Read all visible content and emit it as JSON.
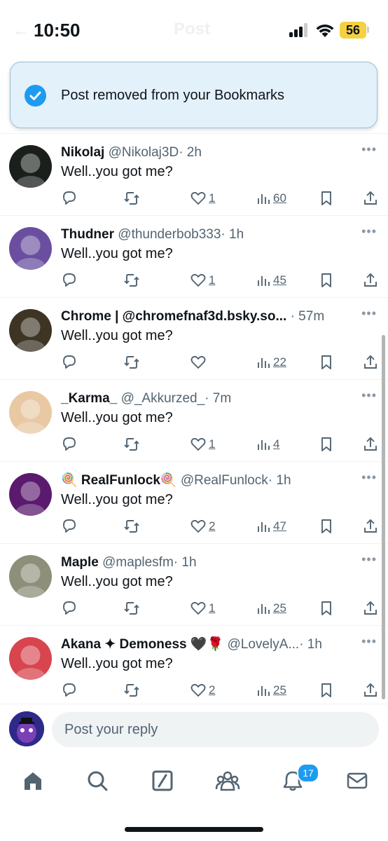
{
  "status_bar": {
    "time": "10:50",
    "battery": "56",
    "faded_title": "Post"
  },
  "toast": {
    "message": "Post removed from your Bookmarks"
  },
  "posts": [
    {
      "name": "Nikolaj",
      "handle": "@Nikolaj3D",
      "time": "· 2h",
      "text": "Well..you got me?",
      "likes": "1",
      "views": "60",
      "avatar_color": "#1a1f1c"
    },
    {
      "name": "Thudner",
      "handle": "@thunderbob333",
      "time": "· 1h",
      "text": "Well..you got me?",
      "likes": "1",
      "views": "45",
      "avatar_color": "#6a4fa0"
    },
    {
      "name": "Chrome | @chromefnaf3d.bsky.so...",
      "handle": "",
      "time": "· 57m",
      "text": "Well..you got me?",
      "likes": "",
      "views": "22",
      "avatar_color": "#3d3424"
    },
    {
      "name": "_Karma_",
      "handle": "@_Akkurzed_",
      "time": "· 7m",
      "text": "Well..you got me?",
      "likes": "1",
      "views": "4",
      "avatar_color": "#e9c8a4"
    },
    {
      "name": "🍭 RealFunlock🍭",
      "handle": "@RealFunlock",
      "time": "· 1h",
      "text": "Well..you got me?",
      "likes": "2",
      "views": "47",
      "avatar_color": "#5a1a6e"
    },
    {
      "name": "Maple",
      "handle": "@maplesfm",
      "time": "· 1h",
      "text": "Well..you got me?",
      "likes": "1",
      "views": "25",
      "avatar_color": "#8d8f7a"
    },
    {
      "name": "Akana ✦ Demoness 🖤🌹",
      "handle": "@LovelyA...",
      "time": "· 1h",
      "text": "Well..you got me?",
      "likes": "2",
      "views": "25",
      "avatar_color": "#d8454f"
    }
  ],
  "more_label": "•••",
  "reply": {
    "placeholder": "Post your reply"
  },
  "nav": {
    "notifications_badge": "17"
  },
  "colors": {
    "accent": "#1d9bf0",
    "muted": "#536471",
    "toast_bg": "#e3f1fb"
  }
}
